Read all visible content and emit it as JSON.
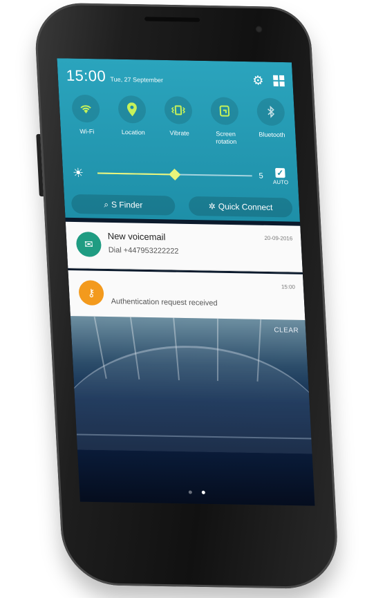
{
  "status_bar": {
    "time": "15:00",
    "date": "Tue, 27 September"
  },
  "quick_toggles": [
    {
      "label": "Wi-Fi",
      "icon": "wifi-icon",
      "state": "on"
    },
    {
      "label": "Location",
      "icon": "location-icon",
      "state": "on"
    },
    {
      "label": "Vibrate",
      "icon": "vibrate-icon",
      "state": "on"
    },
    {
      "label": "Screen rotation",
      "icon": "screen-rotation-icon",
      "state": "on"
    },
    {
      "label": "Bluetooth",
      "icon": "bluetooth-icon",
      "state": "off"
    }
  ],
  "brightness": {
    "level": "5",
    "fraction": 0.5,
    "auto_label": "AUTO",
    "auto_checked": true
  },
  "buttons": {
    "s_finder": "S Finder",
    "quick_connect": "Quick Connect"
  },
  "notifications": [
    {
      "title": "New voicemail",
      "subtitle": "Dial +447953222222",
      "timestamp": "20-09-2016",
      "icon": "voicemail-icon",
      "color": "#1f9c82"
    },
    {
      "title": "",
      "subtitle": "Authentication request received",
      "timestamp": "15:00",
      "icon": "key-icon",
      "color": "#f39a1d"
    }
  ],
  "clear_label": "CLEAR",
  "colors": {
    "panel": "#1e8fa8",
    "accent": "#c6f25a"
  }
}
